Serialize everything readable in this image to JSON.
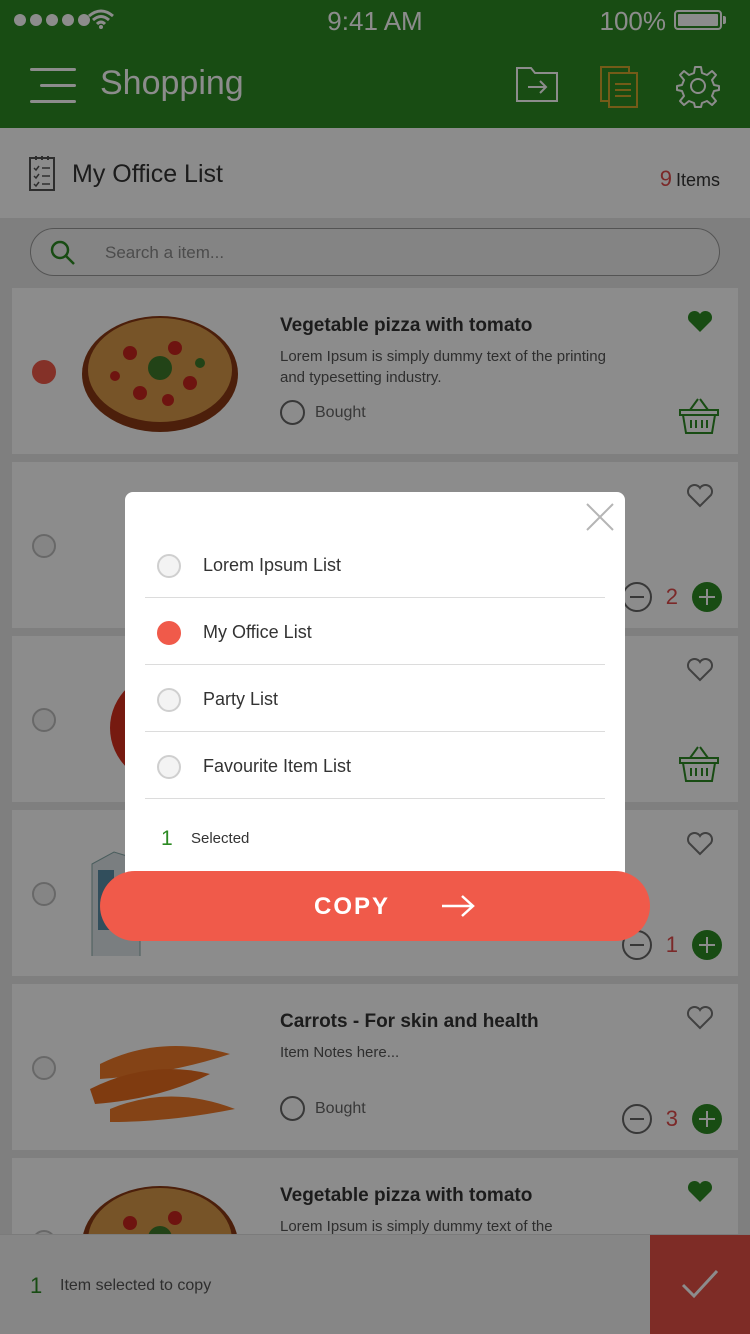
{
  "status_bar": {
    "time": "9:41 AM",
    "battery": "100%"
  },
  "app_bar": {
    "title": "Shopping",
    "icons": [
      "menu-icon",
      "move-to-folder-icon",
      "copy-list-icon",
      "settings-icon"
    ]
  },
  "list_header": {
    "title": "My Office List",
    "count": "9",
    "count_label": "Items"
  },
  "search": {
    "placeholder": "Search a item..."
  },
  "cards": [
    {
      "name": "Vegetable pizza with tomato",
      "desc": "Lorem Ipsum is simply dummy text of the printing and typesetting industry.",
      "bought": "Bought"
    },
    {
      "qty": "2"
    },
    {},
    {
      "qty": "1"
    },
    {
      "name": "Carrots - For skin and health",
      "desc": "Item Notes here...",
      "bought": "Bought",
      "qty": "3"
    },
    {
      "name": "Vegetable pizza with tomato",
      "desc": "Lorem Ipsum is simply dummy text of the"
    }
  ],
  "modal": {
    "options": [
      {
        "label": "Lorem Ipsum List",
        "selected": false
      },
      {
        "label": "My Office List",
        "selected": true
      },
      {
        "label": "Party List",
        "selected": false
      },
      {
        "label": "Favourite Item List",
        "selected": false
      }
    ],
    "selected_count": "1",
    "selected_label": "Selected",
    "button_label": "COPY"
  },
  "bottom_bar": {
    "count": "1",
    "text": "Item selected to copy"
  },
  "colors": {
    "brand_green": "#2c8a23",
    "accent_red": "#f05a4a"
  }
}
